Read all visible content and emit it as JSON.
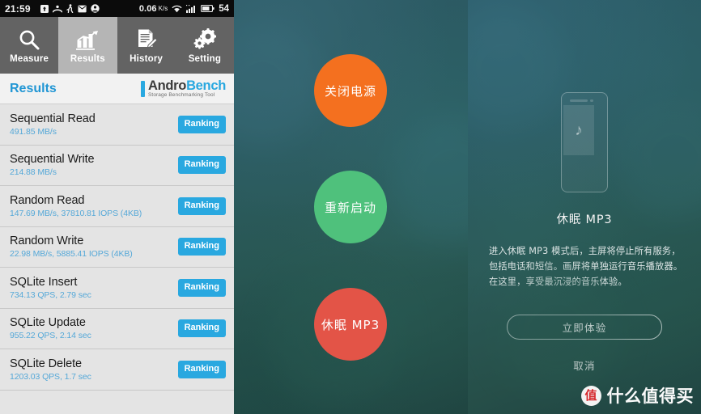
{
  "left_panel": {
    "status_bar": {
      "time": "21:59",
      "icons_left": [
        "upload-box-icon",
        "contacts-icon",
        "pedometer-icon",
        "mail-icon",
        "account-icon"
      ],
      "data_rate": "0.06",
      "data_rate_unit": "K/s",
      "icons_right": [
        "wifi-icon",
        "signal-icon",
        "battery-icon"
      ],
      "battery_level": "54"
    },
    "tabs": [
      {
        "label": "Measure",
        "icon": "magnifier-icon",
        "active": false
      },
      {
        "label": "Results",
        "icon": "bar-chart-icon",
        "active": true
      },
      {
        "label": "History",
        "icon": "document-pencil-icon",
        "active": false
      },
      {
        "label": "Setting",
        "icon": "gears-icon",
        "active": false
      }
    ],
    "title": "Results",
    "logo": {
      "name_part1": "Andro",
      "name_part2": "Bench",
      "tagline": "Storage Benchmarking Tool"
    },
    "results": [
      {
        "name": "Sequential Read",
        "value": "491.85 MB/s",
        "action": "Ranking"
      },
      {
        "name": "Sequential Write",
        "value": "214.88 MB/s",
        "action": "Ranking"
      },
      {
        "name": "Random Read",
        "value": "147.69 MB/s, 37810.81 IOPS (4KB)",
        "action": "Ranking"
      },
      {
        "name": "Random Write",
        "value": "22.98 MB/s, 5885.41 IOPS (4KB)",
        "action": "Ranking"
      },
      {
        "name": "SQLite Insert",
        "value": "734.13 QPS, 2.79 sec",
        "action": "Ranking"
      },
      {
        "name": "SQLite Update",
        "value": "955.22 QPS, 2.14 sec",
        "action": "Ranking"
      },
      {
        "name": "SQLite Delete",
        "value": "1203.03 QPS, 1.7 sec",
        "action": "Ranking"
      }
    ],
    "colors": {
      "accent": "#29a8e0",
      "tab_inactive": "#636363",
      "tab_active": "#b5b5b5",
      "list_bg": "#e4e4e4"
    }
  },
  "middle_panel": {
    "options": [
      {
        "label": "关闭电源",
        "color": "#f4701f",
        "name": "power-off"
      },
      {
        "label": "重新启动",
        "color": "#4fc17c",
        "name": "restart"
      },
      {
        "label": "休眠 MP3",
        "color": "#e35447",
        "name": "sleep-mp3"
      }
    ]
  },
  "right_panel": {
    "illustration": "phone-music-icon",
    "music_note": "♪",
    "title": "休眠 MP3",
    "description_lines": [
      "进入休眠 MP3 模式后，主屏将停止所有服务，",
      "包括电话和短信。画屏将单独运行音乐播放器。",
      "在这里，享受最沉浸的音乐体验。"
    ],
    "primary_button": "立即体验",
    "cancel_button": "取消",
    "watermark": {
      "logo_char": "值",
      "text": "什么值得买"
    }
  }
}
